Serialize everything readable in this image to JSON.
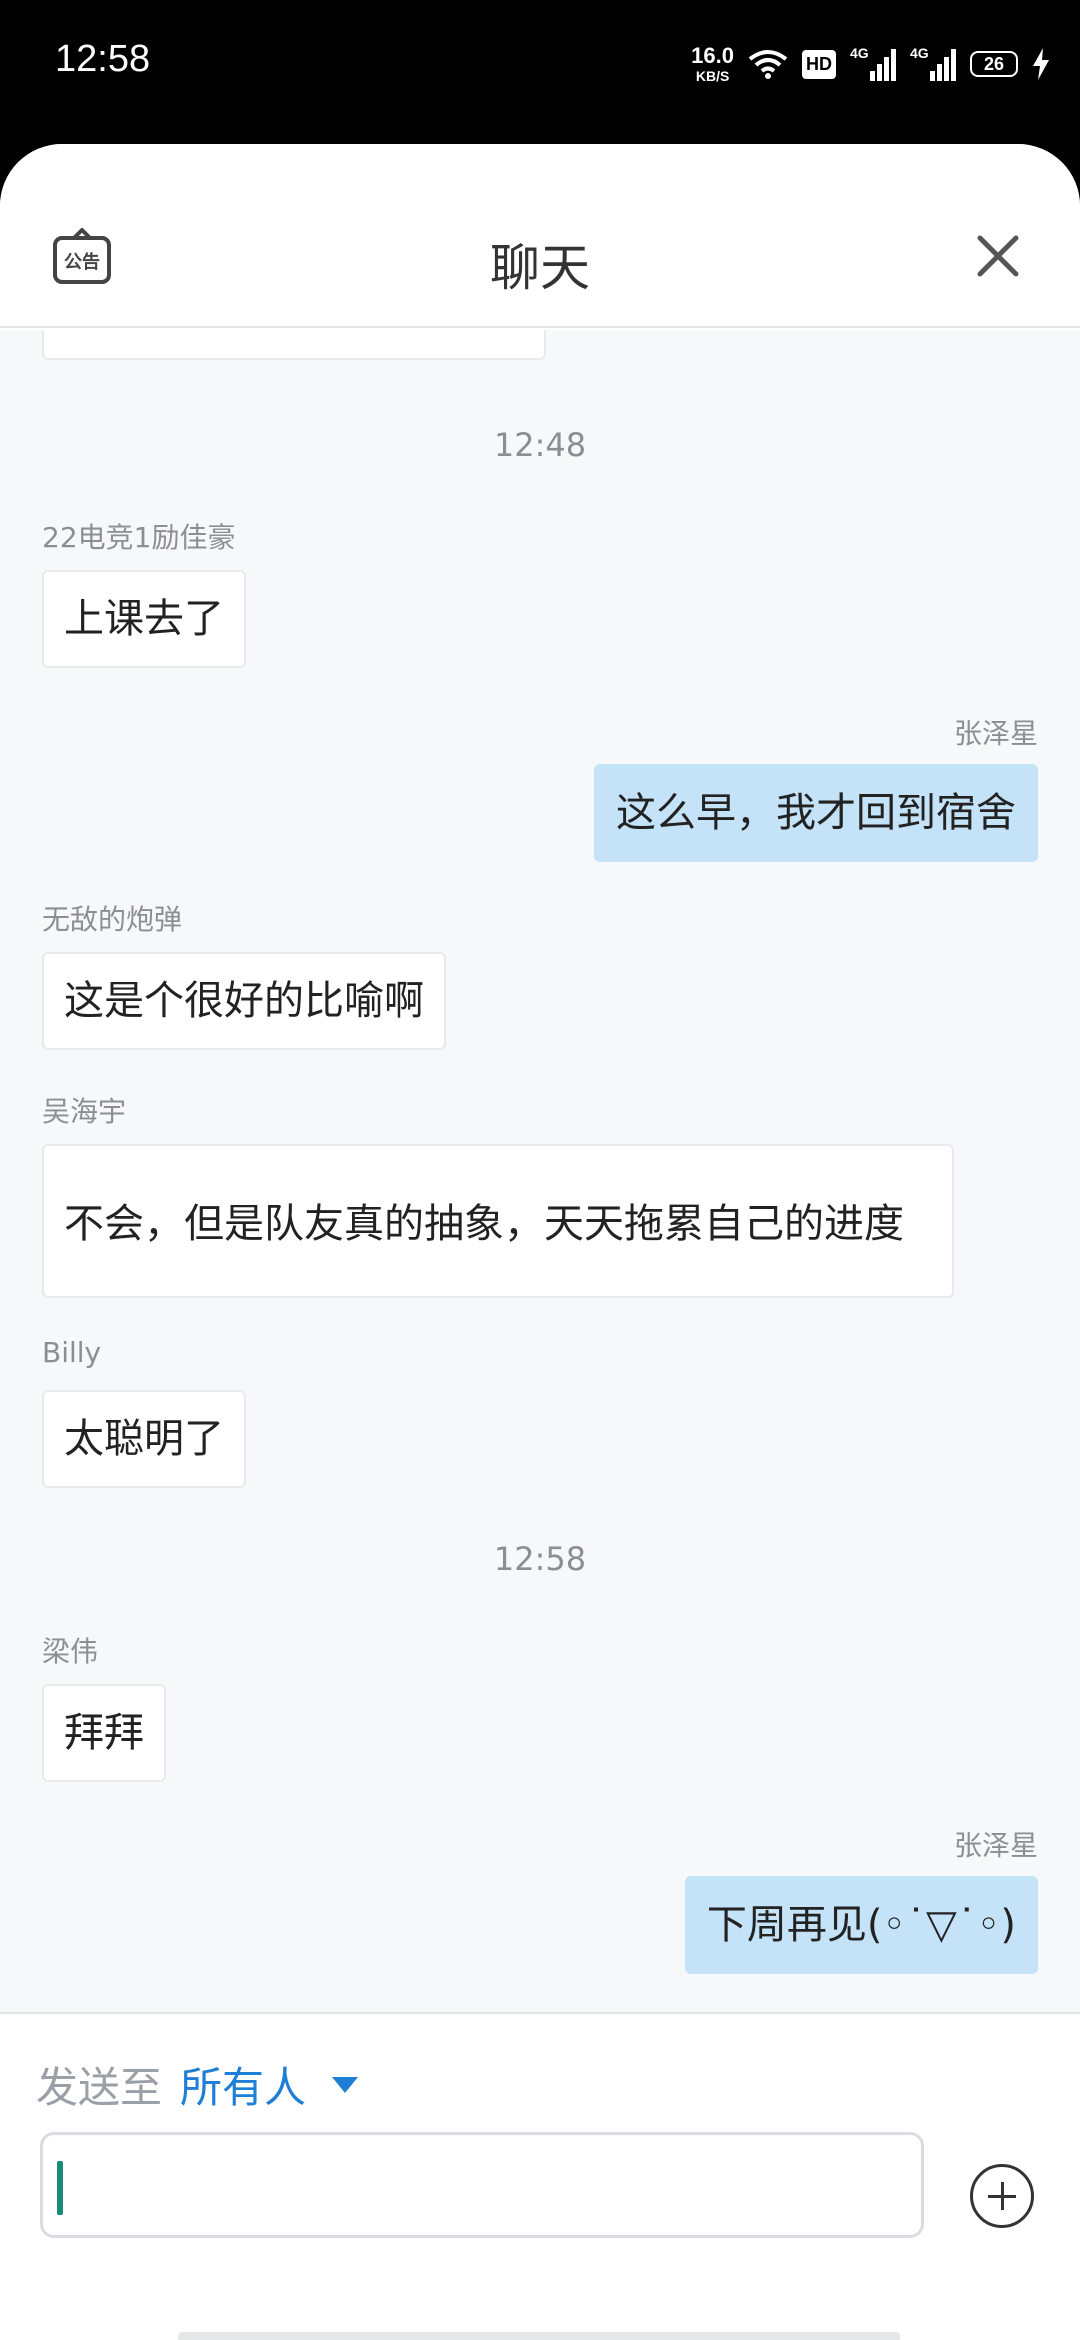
{
  "status_bar": {
    "time": "12:58",
    "net_speed_value": "16.0",
    "net_speed_unit": "KB/S",
    "hd_label": "HD",
    "signal1_label": "4G",
    "signal2_label": "4G",
    "battery_level": "26"
  },
  "header": {
    "title": "聊天",
    "notice_label": "公告"
  },
  "messages": {
    "ts1": "12:48",
    "m1_sender": "22电竞1励佳豪",
    "m1_text": "上课去了",
    "m2_sender": "张泽星",
    "m2_text": "这么早，我才回到宿舍",
    "m3_sender": "无敌的炮弹",
    "m3_text": "这是个很好的比喻啊",
    "m4_sender": "吴海宇",
    "m4_text": "不会，但是队友真的抽象，天天拖累自己的进度",
    "m5_sender": "Billy",
    "m5_text": "太聪明了",
    "ts2": "12:58",
    "m6_sender": "梁伟",
    "m6_text": "拜拜",
    "m7_sender": "张泽星",
    "m7_text": "下周再见(◦˙▽˙◦)"
  },
  "input": {
    "send_to_label": "发送至",
    "recipient": "所有人",
    "value": ""
  },
  "colors": {
    "accent": "#1f7fd6",
    "my_bubble": "#c5e3f8",
    "background": "#f7f8fa"
  }
}
